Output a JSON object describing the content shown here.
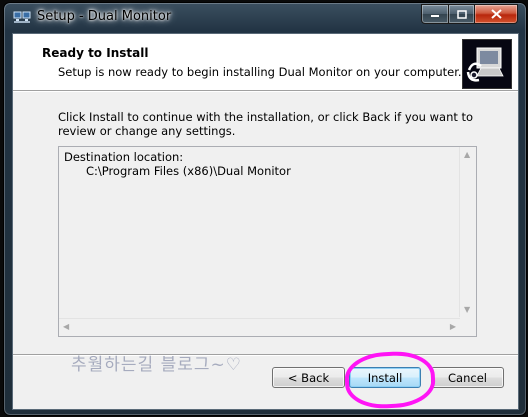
{
  "window": {
    "title": "Setup - Dual Monitor",
    "minimize_icon": "minimize-icon",
    "maximize_icon": "maximize-icon",
    "close_icon": "close-icon"
  },
  "header": {
    "title": "Ready to Install",
    "subtitle": "Setup is now ready to begin installing Dual Monitor on your computer.",
    "logo_icon": "setup-computer-icon"
  },
  "body": {
    "intro": "Click Install to continue with the installation, or click Back if you want to review or change any settings.",
    "memo_label": "Destination location:",
    "memo_path": "C:\\Program Files (x86)\\Dual Monitor"
  },
  "watermark": "추월하는길 블로그~♡",
  "buttons": {
    "back": "< Back",
    "install": "Install",
    "cancel": "Cancel"
  },
  "colors": {
    "highlight": "#ff14f5",
    "default_button_border": "#3c7fb1"
  }
}
